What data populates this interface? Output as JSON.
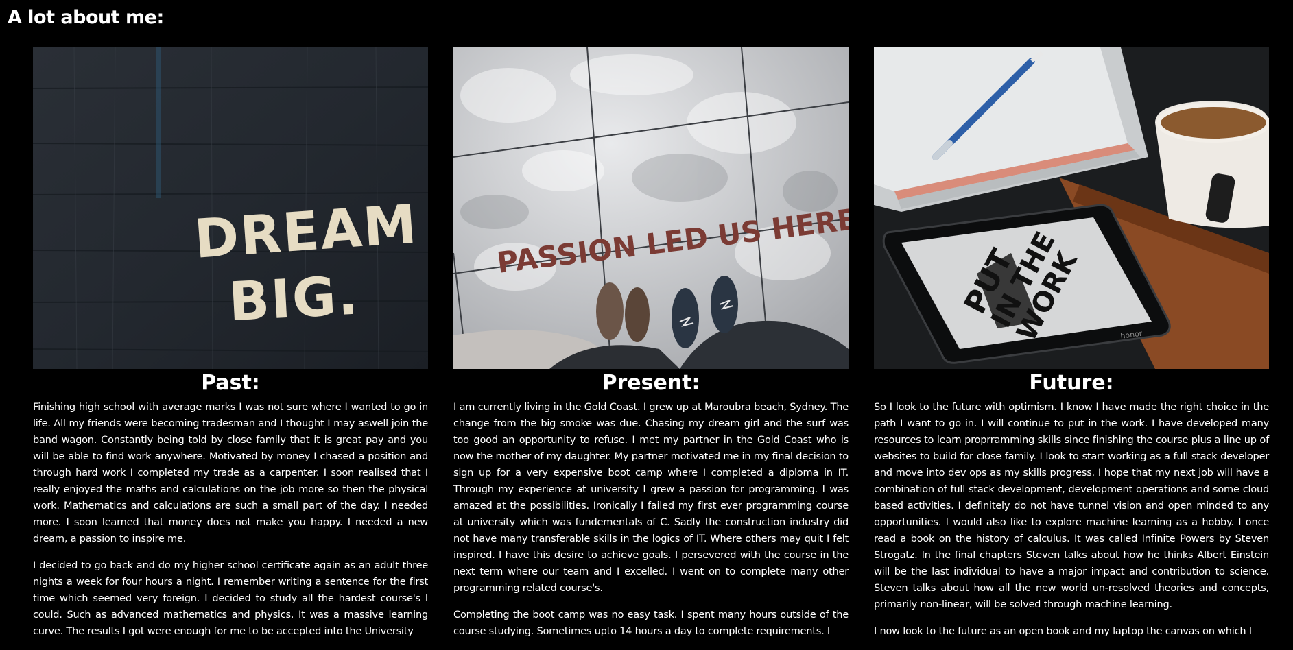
{
  "page": {
    "heading": "A lot about me:"
  },
  "columns": [
    {
      "title": "Past:",
      "image_text": [
        "DREAM",
        "BIG."
      ],
      "paragraphs": [
        "Finishing high school with average marks I was not sure where I wanted to go in life. All my friends were becoming tradesman and I thought I may aswell join the band wagon. Constantly being told by close family that it is great pay and you will be able to find work anywhere. Motivated by money I chased a position and through hard work I completed my trade as a carpenter. I soon realised that I really enjoyed the maths and calculations on the job more so then the physical work. Mathematics and calculations are such a small part of the day. I needed more. I soon learned that money does not make you happy. I needed a new dream, a passion to inspire me.",
        "I decided to go back and do my higher school certificate again as an adult three nights a week for four hours a night. I remember writing a sentence for the first time which seemed very foreign. I decided to study all the hardest course's I could. Such as advanced mathematics and physics. It was a massive learning curve. The results I got were enough for me to be accepted into the University"
      ]
    },
    {
      "title": "Present:",
      "image_text": [
        "PASSION LED US HERE"
      ],
      "paragraphs": [
        "I am currently living in the Gold Coast. I grew up at Maroubra beach, Sydney. The change from the big smoke was due. Chasing my dream girl and the surf was too good an opportunity to refuse. I met my partner in the Gold Coast who is now the mother of my daughter. My partner motivated me in my final decision to sign up for a very expensive boot camp where I completed a diploma in IT. Through my experience at university I grew a passion for programming. I was amazed at the possibilities. Ironically I failed my first ever programming course at university which was fundementals of C. Sadly the construction industry did not have many transferable skills in the logics of IT. Where others may quit I felt inspired. I have this desire to achieve goals. I persevered with the course in the next term where our team and I excelled. I went on to complete many other programming related course's.",
        "Completing the boot camp was no easy task. I spent many hours outside of the course studying. Sometimes upto 14 hours a day to complete requirements. I"
      ]
    },
    {
      "title": "Future:",
      "image_text": [
        "PUT",
        "IN THE",
        "WORK",
        "honor"
      ],
      "paragraphs": [
        "So I look to the future with optimism. I know I have made the right choice in the path I want to go in. I will continue to put in the work. I have developed many resources to learn proprramming skills since finishing the course plus a line up of websites to build for close family. I look to start working as a full stack developer and move into dev ops as my skills progress. I hope that my next job will have a combination of full stack development, development operations and some cloud based activities. I definitely do not have tunnel vision and open minded to any opportunities. I would also like to explore machine learning as a hobby. I once read a book on the history of calculus. It was called Infinite Powers by Steven Strogatz. In the final chapters Steven talks about how he thinks Albert Einstein will be the last individual to have a major impact and contribution to science. Steven talks about how all the new world un-resolved theories and concepts, primarily non-linear, will be solved through machine learning.",
        "I now look to the future as an open book and my laptop the canvas on which I"
      ]
    }
  ]
}
